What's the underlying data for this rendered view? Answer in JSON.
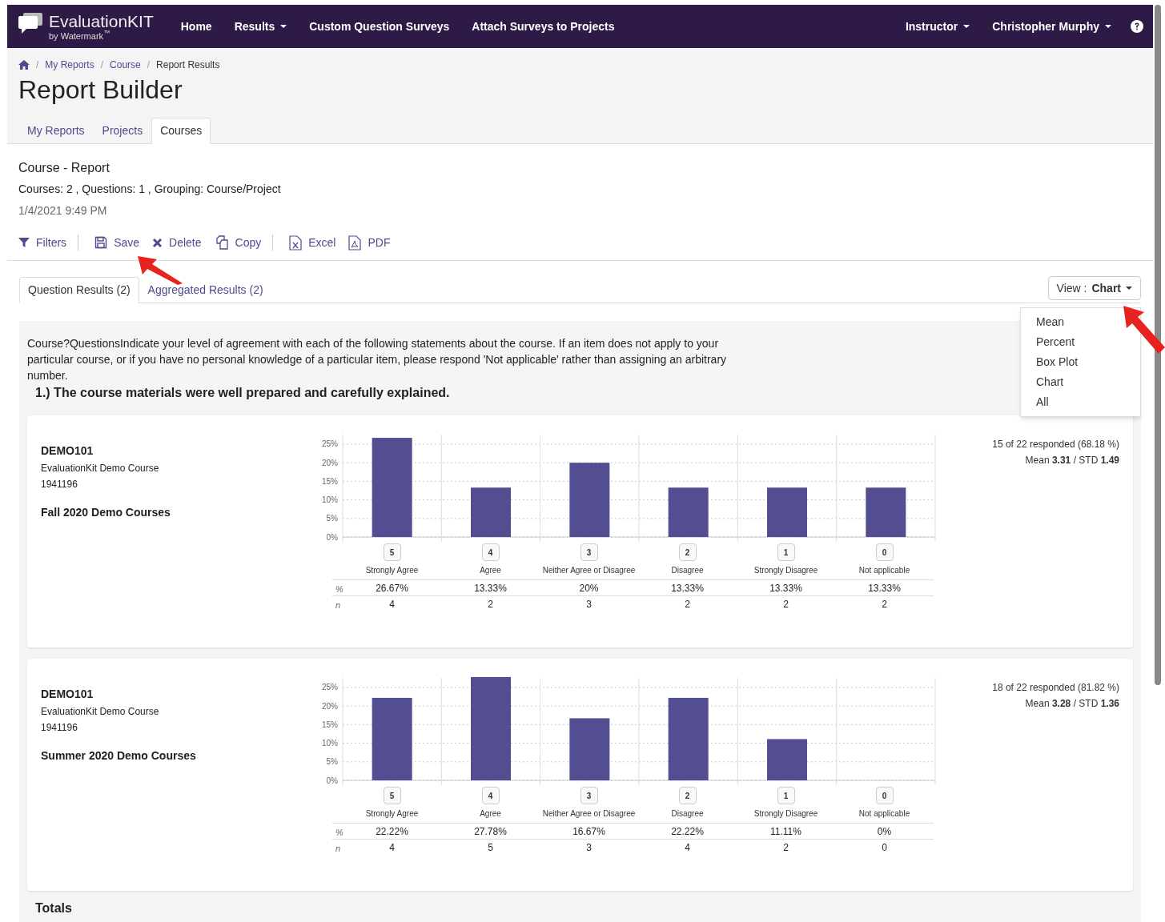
{
  "navbar": {
    "brand": "EvaluationKIT",
    "brand_sub": "by Watermark$^{™}$",
    "items": [
      {
        "label": "Home",
        "dropdown": false
      },
      {
        "label": "Results",
        "dropdown": true
      },
      {
        "label": "Custom Question Surveys",
        "dropdown": false
      },
      {
        "label": "Attach Surveys to Projects",
        "dropdown": false
      }
    ],
    "right_items": [
      {
        "label": "Instructor",
        "dropdown": true
      },
      {
        "label": "Christopher Murphy",
        "dropdown": true
      }
    ]
  },
  "breadcrumb": [
    {
      "separator": "/",
      "label": "My Reports",
      "link": true
    },
    {
      "separator": "/",
      "label": "Course",
      "link": true
    },
    {
      "separator": "/",
      "label": "Report Results",
      "link": false
    }
  ],
  "title": "Report Builder",
  "page_tabs": [
    {
      "label": "My Reports",
      "selected": false
    },
    {
      "label": "Projects",
      "selected": false
    },
    {
      "label": "Courses",
      "selected": true
    }
  ],
  "report": {
    "title": "Course - Report",
    "summary": "Courses: 2 , Questions: 1 , Grouping: Course/Project",
    "date": "1/4/2021 9:49 PM"
  },
  "toolbar": [
    {
      "kind": "filter",
      "label": "Filters",
      "divider_after": true
    },
    {
      "kind": "save",
      "label": "Save",
      "divider_after": false
    },
    {
      "kind": "delete",
      "label": "Delete",
      "divider_after": false
    },
    {
      "kind": "copy",
      "label": "Copy",
      "divider_after": true
    },
    {
      "kind": "excel",
      "label": "Excel",
      "divider_after": false
    },
    {
      "kind": "pdf",
      "label": "PDF",
      "divider_after": false
    }
  ],
  "result_tabs": [
    {
      "label": "Question Results (2)",
      "selected": true
    },
    {
      "label": "Aggregated Results (2)",
      "selected": false
    }
  ],
  "view_button": {
    "label": "View : **Chart**"
  },
  "view_menu": [
    "Mean",
    "Percent",
    "Box Plot",
    "Chart",
    "All"
  ],
  "intro": "Course?QuestionsIndicate your level of agreement with each of the following statements about the course. If an item does not apply to your particular course, or if you have no personal knowledge of a particular item, please respond 'Not applicable' rather than assigning an arbitrary number.",
  "question": "1.) The course materials were well prepared and carefully explained.",
  "groups": [
    {
      "code": "DEMO101",
      "course_name": "EvaluationKit Demo Course",
      "number": "1941196",
      "term": "Fall 2020 Demo Courses",
      "chart_data": {
        "type": "bar",
        "grid": true,
        "categories": [
          "Strongly Agree",
          "Agree",
          "Neither Agree or Disagree",
          "Disagree",
          "Strongly Disagree",
          "Not applicable"
        ],
        "values": [
          26.7,
          13.3,
          20,
          13.3,
          13.3,
          13.3
        ],
        "ylim": [
          0,
          28
        ],
        "yticks": [
          {
            "value": 0,
            "label": "0%"
          },
          {
            "value": 5,
            "label": "5%"
          },
          {
            "value": 10,
            "label": "10%"
          },
          {
            "value": 15,
            "label": "15%"
          },
          {
            "value": 20,
            "label": "20%"
          },
          {
            "value": 25,
            "label": "25%"
          }
        ]
      },
      "codes": [
        "5",
        "4",
        "3",
        "2",
        "1",
        "0"
      ],
      "rows": [
        {
          "label": "%",
          "values": [
            "26.67%",
            "13.33%",
            "20%",
            "13.33%",
            "13.33%",
            "13.33%"
          ]
        },
        {
          "label": "n",
          "values": [
            "4",
            "2",
            "3",
            "2",
            "2",
            "2"
          ]
        }
      ],
      "responded": "15 of 22 responded (68.18 %)",
      "stats": "Mean **3.31** / STD **1.49**"
    },
    {
      "code": "DEMO101",
      "course_name": "EvaluationKit Demo Course",
      "number": "1941196",
      "term": "Summer 2020 Demo Courses",
      "chart_data": {
        "type": "bar",
        "grid": true,
        "categories": [
          "Strongly Agree",
          "Agree",
          "Neither Agree or Disagree",
          "Disagree",
          "Strongly Disagree",
          "Not applicable"
        ],
        "values": [
          22.2,
          27.8,
          16.7,
          22.2,
          11.1,
          0
        ],
        "ylim": [
          0,
          28
        ],
        "yticks": [
          {
            "value": 0,
            "label": "0%"
          },
          {
            "value": 5,
            "label": "5%"
          },
          {
            "value": 10,
            "label": "10%"
          },
          {
            "value": 15,
            "label": "15%"
          },
          {
            "value": 20,
            "label": "20%"
          },
          {
            "value": 25,
            "label": "25%"
          }
        ]
      },
      "codes": [
        "5",
        "4",
        "3",
        "2",
        "1",
        "0"
      ],
      "rows": [
        {
          "label": "%",
          "values": [
            "22.22%",
            "27.78%",
            "16.67%",
            "22.22%",
            "11.11%",
            "0%"
          ]
        },
        {
          "label": "n",
          "values": [
            "4",
            "5",
            "3",
            "4",
            "2",
            "0"
          ]
        }
      ],
      "responded": "18 of 22 responded (81.82 %)",
      "stats": "Mean **3.28** / STD **1.36**"
    }
  ],
  "totals": "Totals"
}
